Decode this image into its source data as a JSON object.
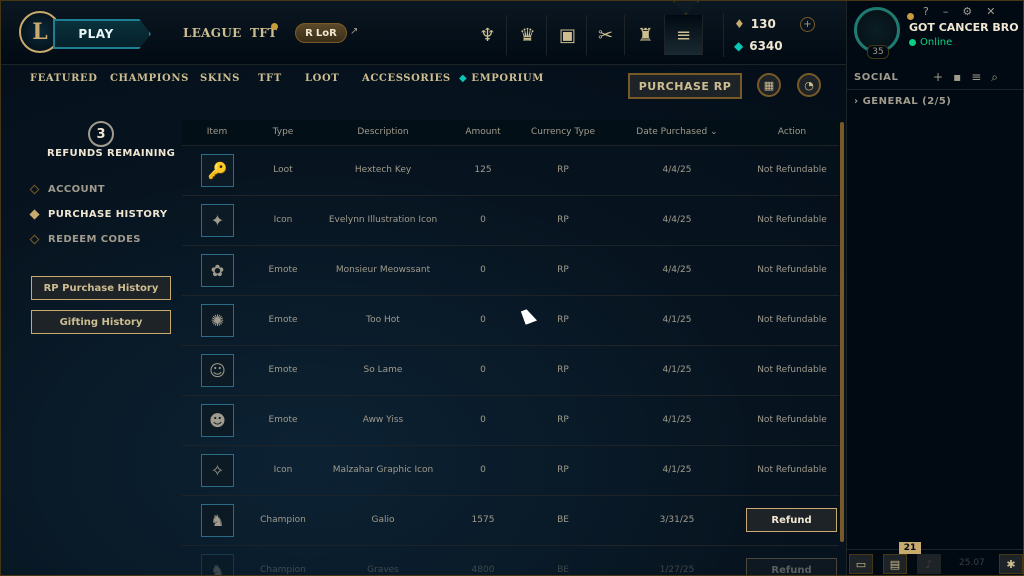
{
  "topbar": {
    "logo_letter": "L",
    "play_label": "PLAY",
    "nav": [
      {
        "label": "LEAGUE"
      },
      {
        "label": "TFT"
      }
    ],
    "lor_label": "LoR",
    "lor_icon": "R",
    "lor_ext_icon": "↗",
    "icons": [
      {
        "name": "clash-icon",
        "glyph": "♆"
      },
      {
        "name": "ranked-icon",
        "glyph": "♛"
      },
      {
        "name": "collection-icon",
        "glyph": "▣"
      },
      {
        "name": "crafting-icon",
        "glyph": "✂"
      },
      {
        "name": "loot-icon",
        "glyph": "♜"
      },
      {
        "name": "store-icon",
        "glyph": "≡"
      }
    ],
    "rp_amount": "130",
    "be_amount": "6340",
    "rp_icon": "♦",
    "be_icon": "◆",
    "plus_icon": "+"
  },
  "profile": {
    "level": "35",
    "summoner_name": "GOT CANCER BRO",
    "status": "Online",
    "window_controls": [
      "?",
      "–",
      "⚙",
      "✕"
    ]
  },
  "subnav": {
    "items": [
      "FEATURED",
      "CHAMPIONS",
      "SKINS",
      "TFT",
      "LOOT",
      "ACCESSORIES"
    ],
    "emporium_label": "EMPORIUM",
    "emporium_icon": "◆",
    "purchase_rp_label": "PURCHASE RP",
    "gift_icon": "▦",
    "account_icon": "◔"
  },
  "social": {
    "title": "SOCIAL",
    "icons": [
      "+",
      "▪",
      "≡",
      "⌕"
    ],
    "group_label": "› GENERAL (2/5)"
  },
  "sidebar": {
    "refunds_count": "3",
    "refunds_label": "REFUNDS REMAINING",
    "items": [
      {
        "label": "ACCOUNT",
        "active": false
      },
      {
        "label": "PURCHASE HISTORY",
        "active": true
      },
      {
        "label": "REDEEM CODES",
        "active": false
      }
    ],
    "rp_history_label": "RP Purchase History",
    "gifting_history_label": "Gifting History"
  },
  "table": {
    "headers": {
      "item": "Item",
      "type": "Type",
      "description": "Description",
      "amount": "Amount",
      "currency": "Currency Type",
      "date": "Date Purchased",
      "date_sort_icon": "⌄",
      "action": "Action"
    },
    "rows": [
      {
        "icon": "🔑",
        "type": "Loot",
        "description": "Hextech Key",
        "amount": "125",
        "currency": "RP",
        "date": "4/4/25",
        "action": "Not Refundable"
      },
      {
        "icon": "✦",
        "type": "Icon",
        "description": "Evelynn Illustration Icon",
        "amount": "0",
        "currency": "RP",
        "date": "4/4/25",
        "action": "Not Refundable"
      },
      {
        "icon": "✿",
        "type": "Emote",
        "description": "Monsieur Meowssant",
        "amount": "0",
        "currency": "RP",
        "date": "4/4/25",
        "action": "Not Refundable"
      },
      {
        "icon": "✺",
        "type": "Emote",
        "description": "Too Hot",
        "amount": "0",
        "currency": "RP",
        "date": "4/1/25",
        "action": "Not Refundable"
      },
      {
        "icon": "☺",
        "type": "Emote",
        "description": "So Lame",
        "amount": "0",
        "currency": "RP",
        "date": "4/1/25",
        "action": "Not Refundable"
      },
      {
        "icon": "☻",
        "type": "Emote",
        "description": "Aww Yiss",
        "amount": "0",
        "currency": "RP",
        "date": "4/1/25",
        "action": "Not Refundable"
      },
      {
        "icon": "✧",
        "type": "Icon",
        "description": "Malzahar Graphic Icon",
        "amount": "0",
        "currency": "RP",
        "date": "4/1/25",
        "action": "Not Refundable"
      },
      {
        "icon": "♞",
        "type": "Champion",
        "description": "Galio",
        "amount": "1575",
        "currency": "BE",
        "date": "3/31/25",
        "action": "Refund"
      },
      {
        "icon": "♞",
        "type": "Champion",
        "description": "Graves",
        "amount": "4800",
        "currency": "BE",
        "date": "1/27/25",
        "action": "Refund"
      }
    ]
  },
  "dock": {
    "chat_icon": "▭",
    "missions_icon": "▤",
    "missions_badge": "21",
    "voice_icon": "♪",
    "version": "25.07",
    "bug_icon": "✱"
  }
}
